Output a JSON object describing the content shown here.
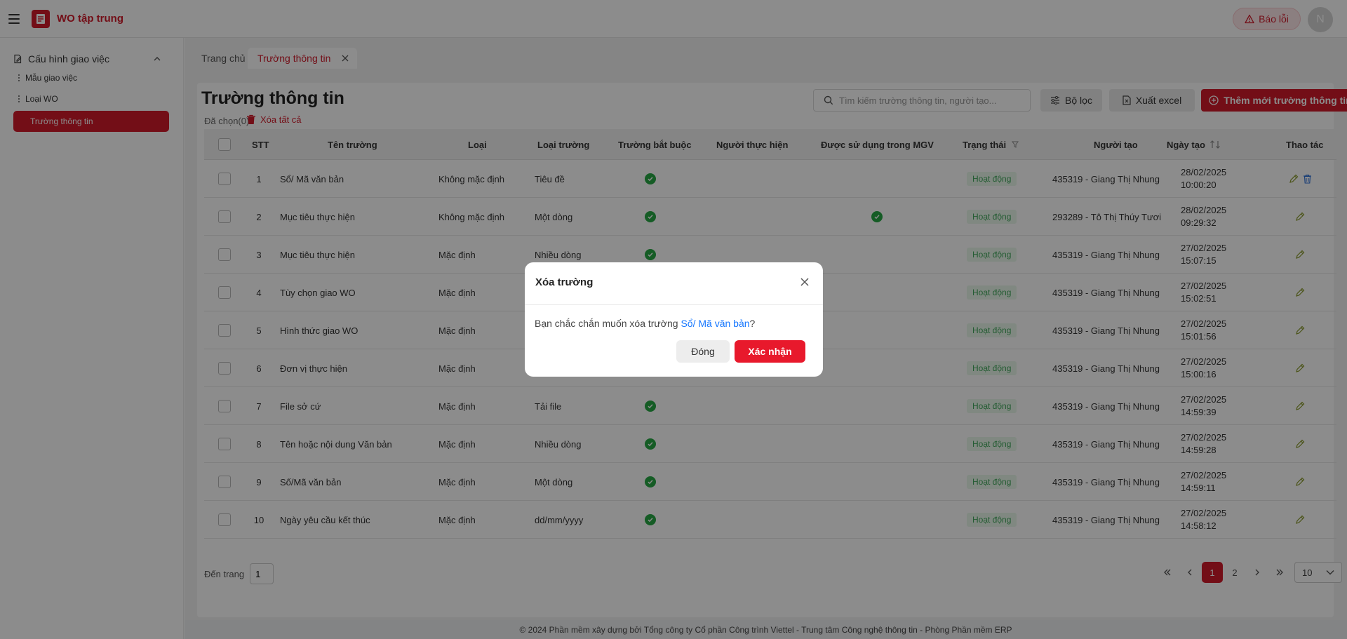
{
  "header": {
    "app_title": "WO tập trung",
    "report_label": "Báo lỗi",
    "avatar_initial": "N"
  },
  "sidebar": {
    "group_label": "Cấu hình giao việc",
    "items": [
      {
        "label": "Mẫu giao việc"
      },
      {
        "label": "Loại WO"
      },
      {
        "label": "Trường thông tin"
      }
    ]
  },
  "tabs": {
    "home": "Trang chủ",
    "active": "Trường thông tin"
  },
  "page": {
    "title": "Trường thông tin",
    "selected_count": "Đã chọn(0)",
    "delete_all": "Xóa tất cả",
    "search_placeholder": "Tìm kiếm trường thông tin, người tạo...",
    "filter_label": "Bộ lọc",
    "export_label": "Xuất excel",
    "add_label": "Thêm mới trường thông tin"
  },
  "table": {
    "columns": {
      "stt": "STT",
      "name": "Tên trường",
      "type": "Loại",
      "field_type": "Loại trường",
      "required": "Trường bắt buộc",
      "assignee": "Người thực hiện",
      "used_in_mgv": "Được sử dụng trong MGV",
      "status": "Trạng thái",
      "creator": "Người tạo",
      "created_date": "Ngày tạo",
      "actions": "Thao tác"
    },
    "rows": [
      {
        "stt": "1",
        "name": "Sổ/ Mã văn bản",
        "type": "Không mặc định",
        "field_type": "Tiêu đề",
        "required": true,
        "used_in_mgv": false,
        "status": "Hoạt động",
        "creator": "435319 - Giang Thị Nhung",
        "date": "28/02/2025",
        "time": "10:00:20",
        "deletable": true
      },
      {
        "stt": "2",
        "name": "Mục tiêu thực hiện",
        "type": "Không mặc định",
        "field_type": "Một dòng",
        "required": true,
        "used_in_mgv": true,
        "status": "Hoạt động",
        "creator": "293289 - Tô Thị Thúy Tươi",
        "date": "28/02/2025",
        "time": "09:29:32",
        "deletable": false
      },
      {
        "stt": "3",
        "name": "Mục tiêu thực hiện",
        "type": "Mặc định",
        "field_type": "Nhiều dòng",
        "required": true,
        "used_in_mgv": false,
        "status": "Hoạt động",
        "creator": "435319 - Giang Thị Nhung",
        "date": "27/02/2025",
        "time": "15:07:15",
        "deletable": false
      },
      {
        "stt": "4",
        "name": "Tùy chọn giao WO",
        "type": "Mặc định",
        "field_type": "",
        "required": false,
        "used_in_mgv": false,
        "status": "Hoạt động",
        "creator": "435319 - Giang Thị Nhung",
        "date": "27/02/2025",
        "time": "15:02:51",
        "deletable": false
      },
      {
        "stt": "5",
        "name": "Hình thức giao WO",
        "type": "Mặc định",
        "field_type": "",
        "required": false,
        "used_in_mgv": false,
        "status": "Hoạt động",
        "creator": "435319 - Giang Thị Nhung",
        "date": "27/02/2025",
        "time": "15:01:56",
        "deletable": false
      },
      {
        "stt": "6",
        "name": "Đơn vị thực hiện",
        "type": "Mặc định",
        "field_type": "",
        "required": false,
        "used_in_mgv": false,
        "status": "Hoạt động",
        "creator": "435319 - Giang Thị Nhung",
        "date": "27/02/2025",
        "time": "15:00:16",
        "deletable": false
      },
      {
        "stt": "7",
        "name": "File sở cứ",
        "type": "Mặc định",
        "field_type": "Tải file",
        "required": true,
        "used_in_mgv": false,
        "status": "Hoạt động",
        "creator": "435319 - Giang Thị Nhung",
        "date": "27/02/2025",
        "time": "14:59:39",
        "deletable": false
      },
      {
        "stt": "8",
        "name": "Tên hoặc nội dung Văn bản",
        "type": "Mặc định",
        "field_type": "Nhiều dòng",
        "required": true,
        "used_in_mgv": false,
        "status": "Hoạt động",
        "creator": "435319 - Giang Thị Nhung",
        "date": "27/02/2025",
        "time": "14:59:28",
        "deletable": false
      },
      {
        "stt": "9",
        "name": "Số/Mã văn bản",
        "type": "Mặc định",
        "field_type": "Một dòng",
        "required": true,
        "used_in_mgv": false,
        "status": "Hoạt động",
        "creator": "435319 - Giang Thị Nhung",
        "date": "27/02/2025",
        "time": "14:59:11",
        "deletable": false
      },
      {
        "stt": "10",
        "name": "Ngày yêu cầu kết thúc",
        "type": "Mặc định",
        "field_type": "dd/mm/yyyy",
        "required": true,
        "used_in_mgv": false,
        "status": "Hoạt động",
        "creator": "435319 - Giang Thị Nhung",
        "date": "27/02/2025",
        "time": "14:58:12",
        "deletable": false
      }
    ]
  },
  "pagination": {
    "goto_label": "Đến trang",
    "goto_value": "1",
    "pages": [
      "1",
      "2"
    ],
    "current_page": "1",
    "page_size": "10"
  },
  "footer": {
    "text": "© 2024 Phần mềm xây dựng bởi Tổng công ty Cổ phần Công trình Viettel - Trung tâm Công nghệ thông tin - Phòng Phần mềm ERP"
  },
  "modal": {
    "title": "Xóa trường",
    "message_prefix": "Bạn chắc chắn muốn xóa trường ",
    "message_link": "Sổ/ Mã văn bản",
    "message_suffix": "?",
    "close_label": "Đóng",
    "confirm_label": "Xác nhận"
  },
  "colors": {
    "brand": "#d11a2a",
    "success": "#27a844",
    "link": "#1677ff"
  }
}
